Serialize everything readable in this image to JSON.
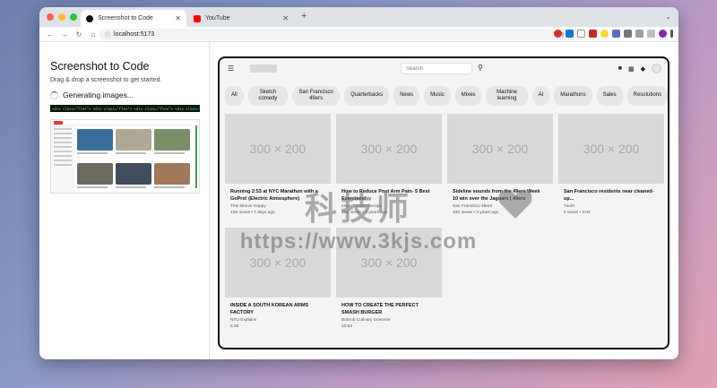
{
  "browser": {
    "tabs": [
      {
        "title": "Screenshot to Code",
        "active": true
      },
      {
        "title": "YouTube",
        "active": false
      }
    ],
    "url": "localhost:5173"
  },
  "left_panel": {
    "title": "Screenshot to Code",
    "subtitle": "Drag & drop a screenshot to get started.",
    "status": "Generating images...",
    "code_snippet": "<div class=\"flex\"> <div class=\"flex\"> <div class=\"flex\"> <div class=\"flex\"> <div class=\"flex\"> <div class=\"flex\"> <div class=\"flex\">"
  },
  "preview": {
    "search_placeholder": "Search",
    "chips": [
      "All",
      "Sketch comedy",
      "San Francisco 49ers",
      "Quarterbacks",
      "News",
      "Music",
      "Mixes",
      "Machine learning",
      "AI",
      "Marathons",
      "Sales",
      "Resolutions"
    ],
    "placeholder_label": "300 × 200",
    "videos": [
      {
        "title": "Running 2:53 at NYC Marathon with a GoPro! (Electric Atmosphere)",
        "channel": "This Minnie Happy",
        "meta": "43K views • 7 days ago"
      },
      {
        "title": "How to Reduce Post Arm Pain- 5 Best Exercises!",
        "channel": "Impact Core Therapy",
        "meta": "35K views • 3 years ago"
      },
      {
        "title": "Sideline sounds from the 49ers Week 10 win over the Jaguars | 49ers",
        "channel": "San Francisco 49ers",
        "meta": "40K views • 3 years ago"
      },
      {
        "title": "San Francisco residents near cleaned-up...",
        "channel": "Youth",
        "meta": "0 views • 3:04"
      },
      {
        "title": "INSIDE A SOUTH KOREAN ARMS FACTORY",
        "channel": "NTU Explains",
        "meta": "5:35"
      },
      {
        "title": "HOW TO CREATE THE PERFECT SMASH BURGER",
        "channel": "Bobrob Culinary Universe",
        "meta": "10:54"
      }
    ]
  },
  "watermark": {
    "line1": "科技师",
    "line2": "https://www.3kjs.com"
  },
  "colors": {
    "close": "#ff5f57",
    "minimize": "#febc2e",
    "maximize": "#28c840",
    "youtube_red": "#ff0000"
  }
}
